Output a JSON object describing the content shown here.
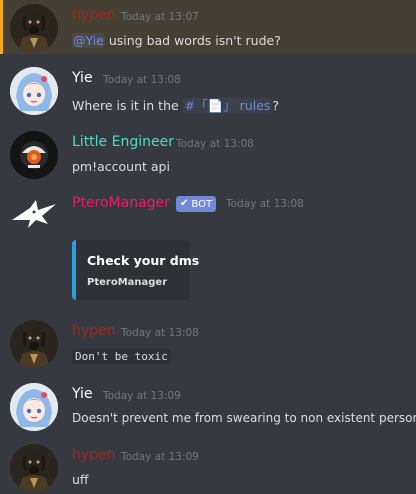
{
  "colors": {
    "background": "#36393f",
    "highlight_background": "#463f33",
    "highlight_bar": "#faa61a",
    "hypen": "#992d22",
    "yie": "#ffffff",
    "little_engineer": "#4fdbc4",
    "pteromanager": "#e91e63",
    "mention": "#7289da",
    "embed_bar": "#2b9ee0"
  },
  "messages": [
    {
      "author": "hypen",
      "timestamp": "Today at 13:07",
      "mention": "@Yie",
      "text": " using bad words isn't rude?",
      "highlighted": true,
      "avatar_icon": "dog-in-suit-avatar"
    },
    {
      "author": "Yie",
      "timestamp": "Today at 13:08",
      "text_before": "Where is it in the ",
      "channel": "#「📄」 rules",
      "text_after": "?",
      "avatar_icon": "anime-girl-avatar"
    },
    {
      "author": "Little Engineer",
      "timestamp": "Today at 13:08",
      "text": "pm!account api",
      "avatar_icon": "round-engineer-avatar"
    },
    {
      "author": "PteroManager",
      "timestamp": "Today at 13:08",
      "bot_tag": "BOT",
      "embed": {
        "title": "Check your dms",
        "footer": "PteroManager"
      },
      "avatar_icon": "pterodactyl-avatar"
    },
    {
      "author": "hypen",
      "timestamp": "Today at 13:08",
      "code": "Don't be toxic",
      "avatar_icon": "dog-in-suit-avatar"
    },
    {
      "author": "Yie",
      "timestamp": "Today at 13:09",
      "text": "Doesn't prevent me from swearing to non existent person",
      "avatar_icon": "anime-girl-avatar"
    },
    {
      "author": "hypen",
      "timestamp": "Today at 13:09",
      "text": "uff",
      "avatar_icon": "dog-in-suit-avatar"
    }
  ]
}
